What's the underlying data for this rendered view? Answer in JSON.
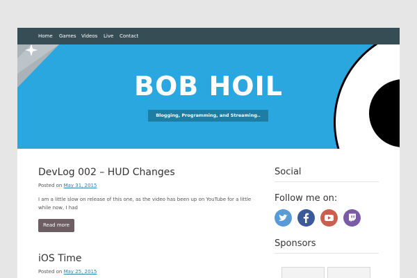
{
  "nav": {
    "items": [
      "Home",
      "Games",
      "Videos",
      "Live",
      "Contact"
    ]
  },
  "header": {
    "title": "BOB HOIL",
    "tagline": "Blogging, Programming, and Streaming.."
  },
  "posts": [
    {
      "title": "DevLog 002 – HUD Changes",
      "posted_label": "Posted on",
      "date": "May 31, 2015",
      "excerpt": "I am a little slow on release of this one, as the video has been up on YouTube for a little while now, I had",
      "read_more": "Read more"
    },
    {
      "title": "iOS Time",
      "posted_label": "Posted on",
      "date": "May 25, 2015"
    }
  ],
  "sidebar": {
    "social_title": "Social",
    "follow_label": "Follow me on:",
    "social_icons": [
      "twitter-icon",
      "facebook-icon",
      "youtube-icon",
      "twitch-icon"
    ],
    "sponsors_title": "Sponsors"
  },
  "colors": {
    "nav_bg": "#364d55",
    "hero_bg": "#2ba7df",
    "tagline_bg": "#1f7da3",
    "button_bg": "#6c5e63",
    "twitter": "#5a9bd5",
    "facebook": "#3c5a99",
    "youtube": "#c8604f",
    "twitch": "#7b5ba6"
  }
}
